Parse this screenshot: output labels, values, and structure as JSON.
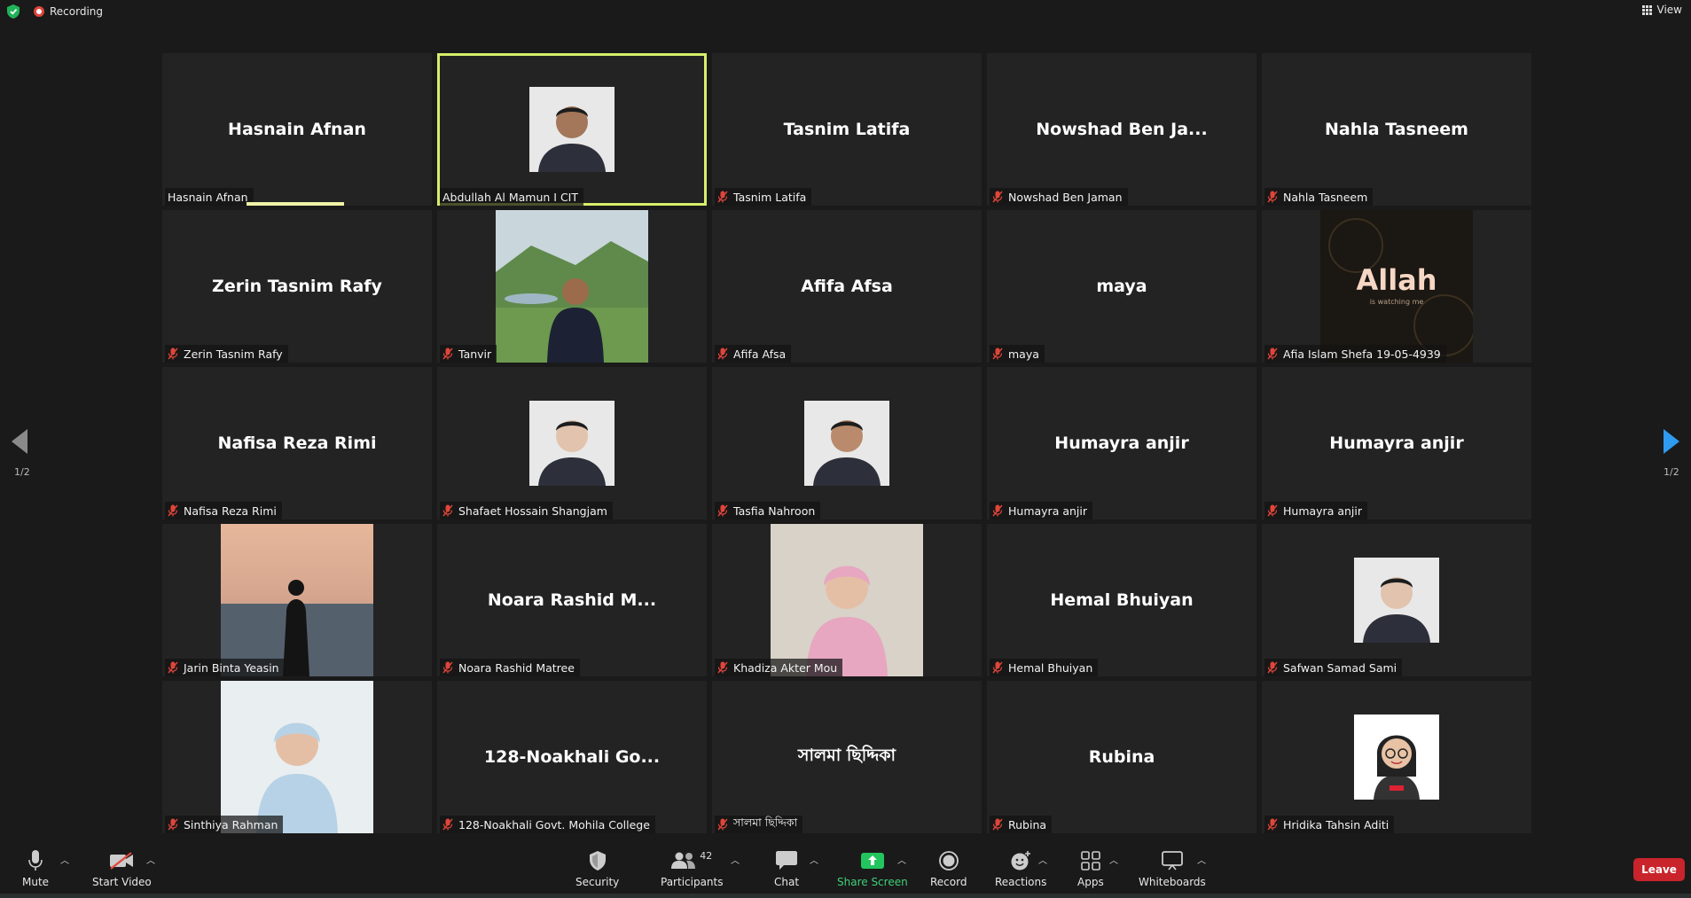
{
  "topbar": {
    "recording_label": "Recording",
    "view_label": "View"
  },
  "participants": [
    {
      "tile_name": "Hasnain Afnan",
      "label": "Hasnain Afnan",
      "muted": false,
      "photo": null,
      "speaking": true
    },
    {
      "tile_name": "",
      "label": "Abdullah Al Mamun I CIT",
      "muted": false,
      "photo": "profile-photo",
      "active": true
    },
    {
      "tile_name": "Tasnim Latifa",
      "label": "Tasnim Latifa",
      "muted": true,
      "photo": null
    },
    {
      "tile_name": "Nowshad  Ben  Ja...",
      "label": "Nowshad Ben Jaman",
      "muted": true,
      "photo": null
    },
    {
      "tile_name": "Nahla Tasneem",
      "label": "Nahla Tasneem",
      "muted": true,
      "photo": null
    },
    {
      "tile_name": "Zerin Tasnim Rafy",
      "label": "Zerin Tasnim Rafy",
      "muted": true,
      "photo": null
    },
    {
      "tile_name": "",
      "label": "Tanvir",
      "muted": true,
      "photo": "video-landscape"
    },
    {
      "tile_name": "Afifa Afsa",
      "label": "Afifa Afsa",
      "muted": true,
      "photo": null
    },
    {
      "tile_name": "maya",
      "label": "maya",
      "muted": true,
      "photo": null
    },
    {
      "tile_name": "",
      "label": "Afia Islam Shefa 19-05-4939",
      "muted": true,
      "photo": "video-logo",
      "logo_text": "Allah",
      "logo_subtext": "is watching me"
    },
    {
      "tile_name": "Nafisa Reza Rimi",
      "label": "Nafisa Reza Rimi",
      "muted": true,
      "photo": null
    },
    {
      "tile_name": "",
      "label": "Shafaet Hossain Shangjam",
      "muted": true,
      "photo": "profile-photo"
    },
    {
      "tile_name": "",
      "label": "Tasfia Nahroon",
      "muted": true,
      "photo": "profile-photo"
    },
    {
      "tile_name": "Humayra anjir",
      "label": "Humayra anjir",
      "muted": true,
      "photo": null
    },
    {
      "tile_name": "Humayra anjir",
      "label": "Humayra anjir",
      "muted": true,
      "photo": null
    },
    {
      "tile_name": "",
      "label": "Jarin Binta Yeasin",
      "muted": true,
      "photo": "video-beach"
    },
    {
      "tile_name": "Noara  Rashid  M...",
      "label": "Noara Rashid Matree",
      "muted": true,
      "photo": null
    },
    {
      "tile_name": "",
      "label": "Khadiza Akter Mou",
      "muted": true,
      "photo": "video-portrait"
    },
    {
      "tile_name": "Hemal Bhuiyan",
      "label": "Hemal Bhuiyan",
      "muted": true,
      "photo": null
    },
    {
      "tile_name": "",
      "label": "Safwan Samad Sami",
      "muted": true,
      "photo": "profile-photo"
    },
    {
      "tile_name": "",
      "label": "Sinthiya Rahman",
      "muted": true,
      "photo": "video-portrait"
    },
    {
      "tile_name": "128-Noakhali  Go...",
      "label": "128-Noakhali Govt. Mohila College",
      "muted": true,
      "photo": null
    },
    {
      "tile_name": "সালমা ছিদ্দিকা",
      "label": "সালমা ছিদ্দিকা",
      "muted": true,
      "photo": null
    },
    {
      "tile_name": "Rubina",
      "label": "Rubina",
      "muted": true,
      "photo": null
    },
    {
      "tile_name": "",
      "label": "Hridika Tahsin Aditi",
      "muted": true,
      "photo": "avatar-cartoon"
    }
  ],
  "pagination": {
    "left": "1/2",
    "right": "1/2"
  },
  "toolbar": {
    "mute": "Mute",
    "start_video": "Start Video",
    "security": "Security",
    "participants": "Participants",
    "participants_count": "42",
    "chat": "Chat",
    "share_screen": "Share Screen",
    "record": "Record",
    "reactions": "Reactions",
    "apps": "Apps",
    "whiteboards": "Whiteboards",
    "leave": "Leave"
  },
  "colors": {
    "active_border": "#d7ef6a",
    "share_green": "#23c55e",
    "leave_red": "#c9242b",
    "nav_blue": "#2e9bf0"
  }
}
